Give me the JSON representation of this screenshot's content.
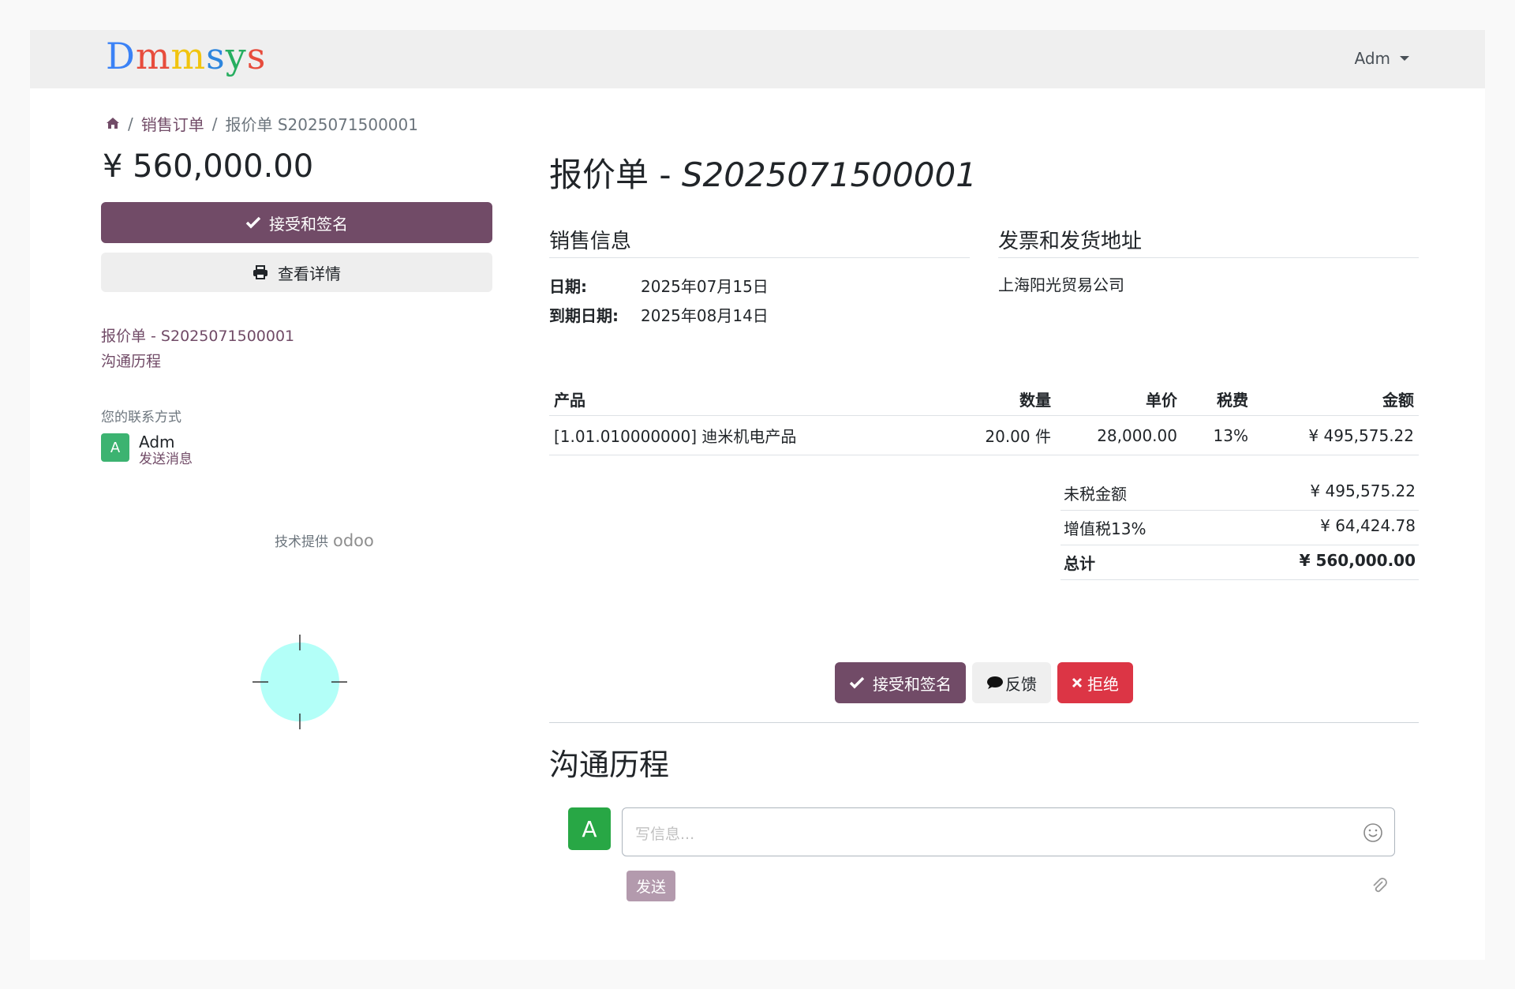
{
  "header": {
    "logo_letters": [
      {
        "ch": "D",
        "color": "#3b82f6"
      },
      {
        "ch": "m",
        "color": "#e74c3c"
      },
      {
        "ch": "m",
        "color": "#f1c40f"
      },
      {
        "ch": "s",
        "color": "#2e86de"
      },
      {
        "ch": "y",
        "color": "#27ae60"
      },
      {
        "ch": "s",
        "color": "#e74c3c"
      }
    ],
    "user_name": "Adm"
  },
  "breadcrumb": {
    "home_icon": "home-icon",
    "sep1": "/",
    "sales_orders": "销售订单",
    "sep2": "/",
    "current": "报价单 S2025071500001"
  },
  "sidebar": {
    "amount": "¥ 560,000.00",
    "accept_label": "接受和签名",
    "view_details_label": "查看详情",
    "nav_quote": "报价单 - S2025071500001",
    "nav_history": "沟通历程",
    "contact_title": "您的联系方式",
    "contact_avatar": "A",
    "contact_name": "Adm",
    "contact_send": "发送消息",
    "powered_by": "技术提供",
    "powered_brand": "odoo"
  },
  "main": {
    "title_prefix": "报价单 - ",
    "title_number": "S2025071500001",
    "sales_info_title": "销售信息",
    "date_label": "日期:",
    "date_value": "2025年07月15日",
    "due_label": "到期日期:",
    "due_value": "2025年08月14日",
    "address_title": "发票和发货地址",
    "company": "上海阳光贸易公司",
    "table": {
      "headers": {
        "product": "产品",
        "qty": "数量",
        "price": "单价",
        "tax": "税费",
        "amount": "金额"
      },
      "rows": [
        {
          "product": "[1.01.010000000] 迪米机电产品",
          "qty": "20.00 件",
          "price": "28,000.00",
          "tax": "13%",
          "amount": "¥ 495,575.22"
        }
      ]
    },
    "totals": {
      "untaxed_label": "未税金额",
      "untaxed_value": "¥ 495,575.22",
      "vat_label": "增值税13%",
      "vat_value": "¥ 64,424.78",
      "total_label": "总计",
      "total_value": "¥ 560,000.00"
    },
    "actions": {
      "accept": "接受和签名",
      "feedback": "反馈",
      "reject": "拒绝"
    },
    "chatter": {
      "title": "沟通历程",
      "avatar": "A",
      "placeholder": "写信息...",
      "send": "发送"
    }
  },
  "colors": {
    "primary": "#714b67",
    "danger": "#dc3545",
    "avatar_green": "#28a745"
  }
}
